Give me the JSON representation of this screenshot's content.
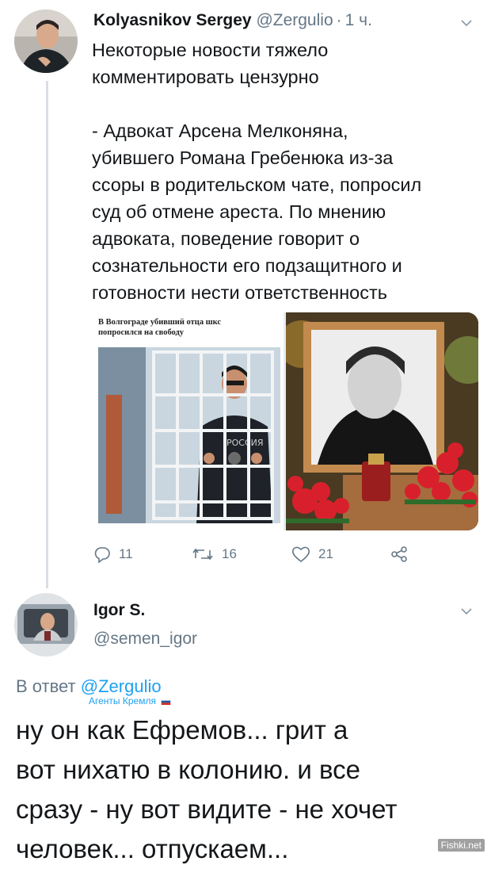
{
  "tweet1": {
    "author_name": "Kolyasnikov Sergey",
    "author_handle": "@Zergulio",
    "dot": "·",
    "time": "1 ч.",
    "text": "Некоторые новости тяжело\nкомментировать цензурно\n\n- Адвокат Арсена Мелконяна,\nубившего Романа Гребенюка из-за\nссоры в родительском чате, попросил\nсуд об отмене ареста. По мнению\nадвоката, поведение говорит о\nсознательности его подзащитного и\nготовности нести ответственность",
    "media": {
      "left_caption": "В Волгограде убивший отца шкс\nпопросился на свободу",
      "left_image": "man-behind-bars-photo",
      "right_image": "memorial-portrait-with-flowers-photo"
    },
    "actions": {
      "reply_count": "11",
      "retweet_count": "16",
      "like_count": "21"
    }
  },
  "tweet2": {
    "author_name": "Igor S.",
    "author_handle": "@semen_igor",
    "reply_prefix": "В ответ",
    "reply_to": "@Zergulio",
    "reply_badge": "Агенты Кремля",
    "text": "ну он как Ефремов... грит а\nвот нихатю в колонию. и все\nсразу - ну вот видите - не хочет\nчеловек... отпускаем..."
  },
  "watermark": "Fishki.net",
  "colors": {
    "text": "#14171a",
    "muted": "#657786",
    "link": "#1da1f2",
    "thread_line": "#d9dfe4"
  }
}
